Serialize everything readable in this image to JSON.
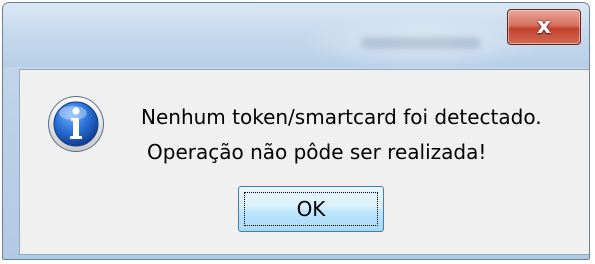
{
  "window": {
    "title": "",
    "close_label": "x"
  },
  "dialog": {
    "icon": "info-icon",
    "message_line1": "Nenhum token/smartcard foi detectado.",
    "message_line2": "Operação não pôde ser realizada!",
    "ok_label": "OK"
  },
  "colors": {
    "close_button": "#c2412b",
    "info_icon": "#1b5fc4",
    "ok_button_border": "#3c7fb1"
  }
}
